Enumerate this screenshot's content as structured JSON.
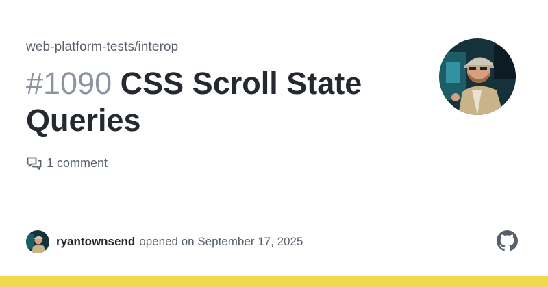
{
  "repo": {
    "name": "web-platform-tests/interop"
  },
  "issue": {
    "number": "#1090",
    "title": "CSS Scroll State Queries"
  },
  "meta": {
    "comments": "1 comment"
  },
  "author": {
    "username": "ryantownsend",
    "opened_text": "opened on September 17, 2025"
  },
  "icons": {
    "comments": "comment-discussion-icon",
    "logo": "github-logo-icon"
  },
  "colors": {
    "accent_bar": "#f0d94c",
    "title": "#24292f",
    "muted": "#57606a",
    "issue_number": "#8c959f"
  }
}
